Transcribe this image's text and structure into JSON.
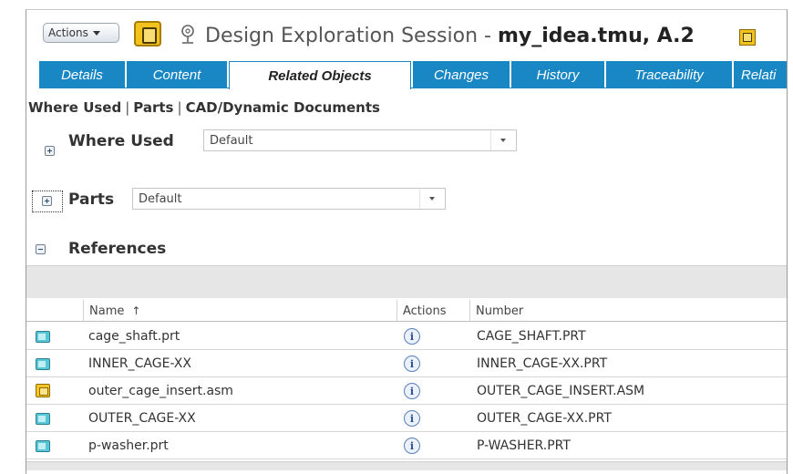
{
  "header": {
    "actions_label": "Actions",
    "title_prefix": "Design Exploration Session",
    "title_sep": " - ",
    "title_object": "my_idea.tmu, A.2"
  },
  "tabs": [
    {
      "label": "Details",
      "active": false
    },
    {
      "label": "Content",
      "active": false
    },
    {
      "label": "Related Objects",
      "active": true
    },
    {
      "label": "Changes",
      "active": false
    },
    {
      "label": "History",
      "active": false
    },
    {
      "label": "Traceability",
      "active": false
    },
    {
      "label": "Relati",
      "active": false
    }
  ],
  "subnav": {
    "items": [
      "Where Used",
      "Parts",
      "CAD/Dynamic Documents"
    ]
  },
  "sections": {
    "where_used": {
      "label": "Where Used",
      "view": "Default"
    },
    "parts": {
      "label": "Parts",
      "view": "Default"
    },
    "references": {
      "label": "References"
    }
  },
  "table": {
    "columns": {
      "name": "Name",
      "sort_indicator": "↑",
      "actions": "Actions",
      "number": "Number"
    },
    "rows": [
      {
        "icon": "part-icon",
        "name": "cage_shaft.prt",
        "number": "CAGE_SHAFT.PRT"
      },
      {
        "icon": "part-icon",
        "name": "INNER_CAGE-XX",
        "number": "INNER_CAGE-XX.PRT"
      },
      {
        "icon": "assembly-icon",
        "name": "outer_cage_insert.asm",
        "number": "OUTER_CAGE_INSERT.ASM"
      },
      {
        "icon": "part-icon",
        "name": "OUTER_CAGE-XX",
        "number": "OUTER_CAGE-XX.PRT"
      },
      {
        "icon": "part-icon",
        "name": "p-washer.prt",
        "number": "P-WASHER.PRT"
      }
    ]
  },
  "icons": {
    "info": "i"
  },
  "colors": {
    "tab_blue": "#1a87c5",
    "object_yellow": "#f4c21c",
    "part_cyan": "#59c6d6"
  }
}
